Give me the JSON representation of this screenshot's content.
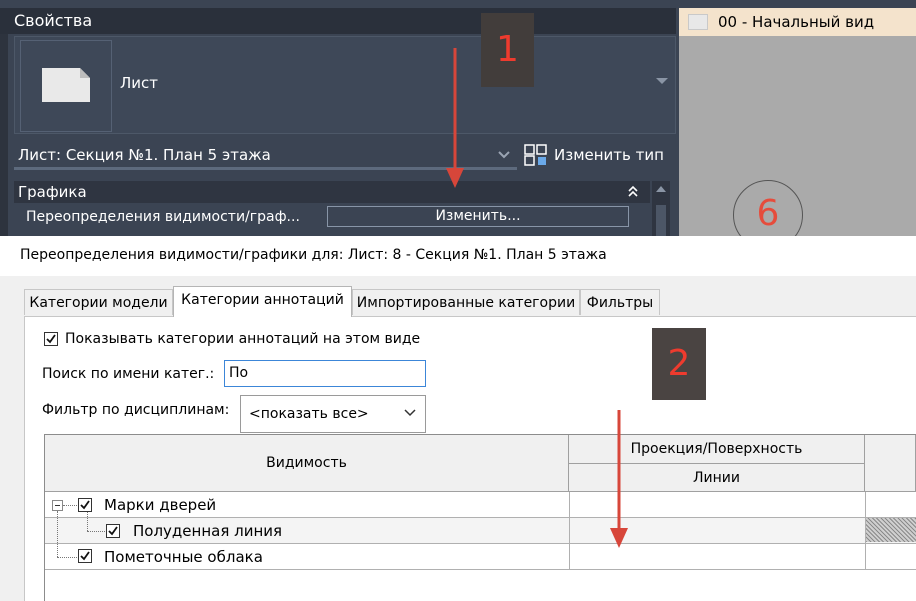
{
  "properties": {
    "title": "Свойства",
    "type_name": "Лист",
    "instance_selector": "Лист: Секция №1. План 5 этажа",
    "edit_type_label": "Изменить тип",
    "section": "Графика",
    "rows": [
      {
        "label": "Переопределения видимости/граф...",
        "value": "Изменить..."
      }
    ]
  },
  "view_tab": {
    "label": "00 - Начальный вид",
    "grid_label": "6"
  },
  "markers": {
    "m1": "1",
    "m2": "2"
  },
  "dialog": {
    "title": "Переопределения видимости/графики для: Лист: 8 - Секция №1. План 5 этажа",
    "tabs": [
      {
        "label": "Категории модели",
        "active": false
      },
      {
        "label": "Категории аннотаций",
        "active": true
      },
      {
        "label": "Импортированные категории",
        "active": false
      },
      {
        "label": "Фильтры",
        "active": false
      }
    ],
    "show_annotation_label": "Показывать категории аннотаций на этом виде",
    "show_annotation_checked": true,
    "search_label": "Поиск по имени катег.:",
    "search_value": "По",
    "filter_label": "Фильтр по дисциплинам:",
    "filter_value": "<показать все>",
    "table": {
      "col_visibility": "Видимость",
      "col_projection": "Проекция/Поверхность",
      "col_lines": "Линии",
      "rows": [
        {
          "label": "Марки дверей",
          "checked": true,
          "level": 0
        },
        {
          "label": "Полуденная линия",
          "checked": true,
          "level": 1
        },
        {
          "label": "Пометочные облака",
          "checked": true,
          "level": 0
        }
      ]
    }
  },
  "colors": {
    "panel_bg": "#3b4453",
    "panel_header": "#2a303b",
    "marker_text": "#ee3b2e",
    "view_tab_bg": "#f4e3cc",
    "input_focus": "#3c86d8"
  }
}
